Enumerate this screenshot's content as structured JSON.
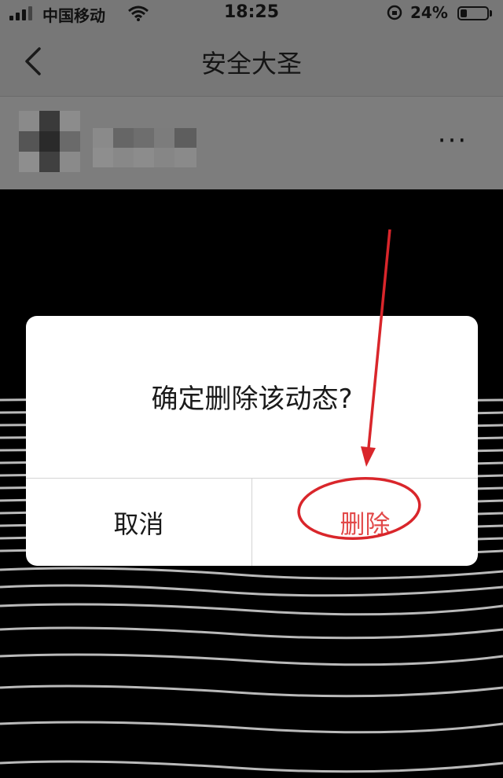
{
  "status_bar": {
    "carrier": "中国移动",
    "time": "18:25",
    "battery_percent": "24%",
    "battery_level": 0.24
  },
  "nav": {
    "title": "安全大圣"
  },
  "post_header": {
    "more_label": "···"
  },
  "dialog": {
    "message": "确定删除该动态?",
    "cancel_label": "取消",
    "confirm_label": "删除"
  },
  "colors": {
    "overlay_gray": "#777777",
    "confirm_text": "#e24a4a",
    "annotation_red": "#d9262b"
  }
}
